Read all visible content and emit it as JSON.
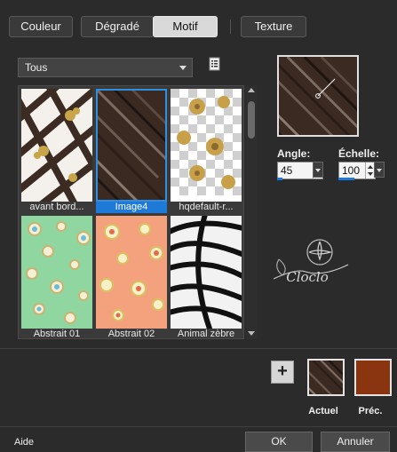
{
  "tabs": [
    {
      "label": "Couleur",
      "active": false
    },
    {
      "label": "Dégradé",
      "active": false
    },
    {
      "label": "Motif",
      "active": true
    },
    {
      "label": "Texture",
      "active": false
    }
  ],
  "category": {
    "selected": "Tous"
  },
  "patterns": [
    {
      "name": "avant bord...",
      "selected": false
    },
    {
      "name": "Image4",
      "selected": true
    },
    {
      "name": "hqdefault-r...",
      "selected": false
    },
    {
      "name": "Abstrait 01",
      "selected": false
    },
    {
      "name": "Abstrait 02",
      "selected": false
    },
    {
      "name": "Animal zèbre",
      "selected": false
    }
  ],
  "angle": {
    "label": "Angle:",
    "value": "45"
  },
  "scale": {
    "label": "Échelle:",
    "value": "100"
  },
  "watermark": {
    "text": "Cloclo"
  },
  "swatches": {
    "current_label": "Actuel",
    "previous_label": "Préc.",
    "previous_color": "#8a3410"
  },
  "footer": {
    "help": "Aide",
    "ok": "OK",
    "cancel": "Annuler"
  }
}
